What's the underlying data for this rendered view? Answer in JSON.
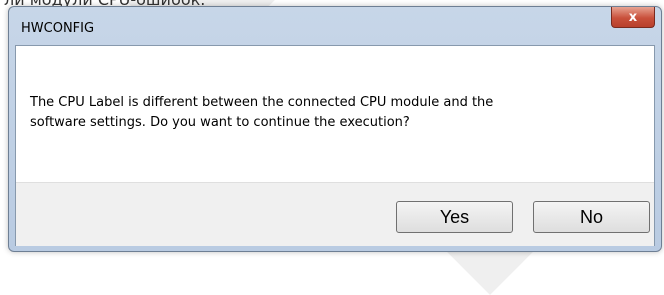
{
  "caption": "ли модули CPU-ошибок.",
  "dialog": {
    "title": "HWCONFIG",
    "close_glyph": "x",
    "message_line1": "The CPU Label is different between the connected CPU module and the",
    "message_line2": "software settings. Do you want to continue the execution?",
    "buttons": {
      "yes_label": "Yes",
      "no_label": "No"
    }
  },
  "colors": {
    "frame": "#b9cbe2",
    "close_button": "#c9503b",
    "client": "#f0f0f0",
    "message_bg": "#ffffff"
  }
}
